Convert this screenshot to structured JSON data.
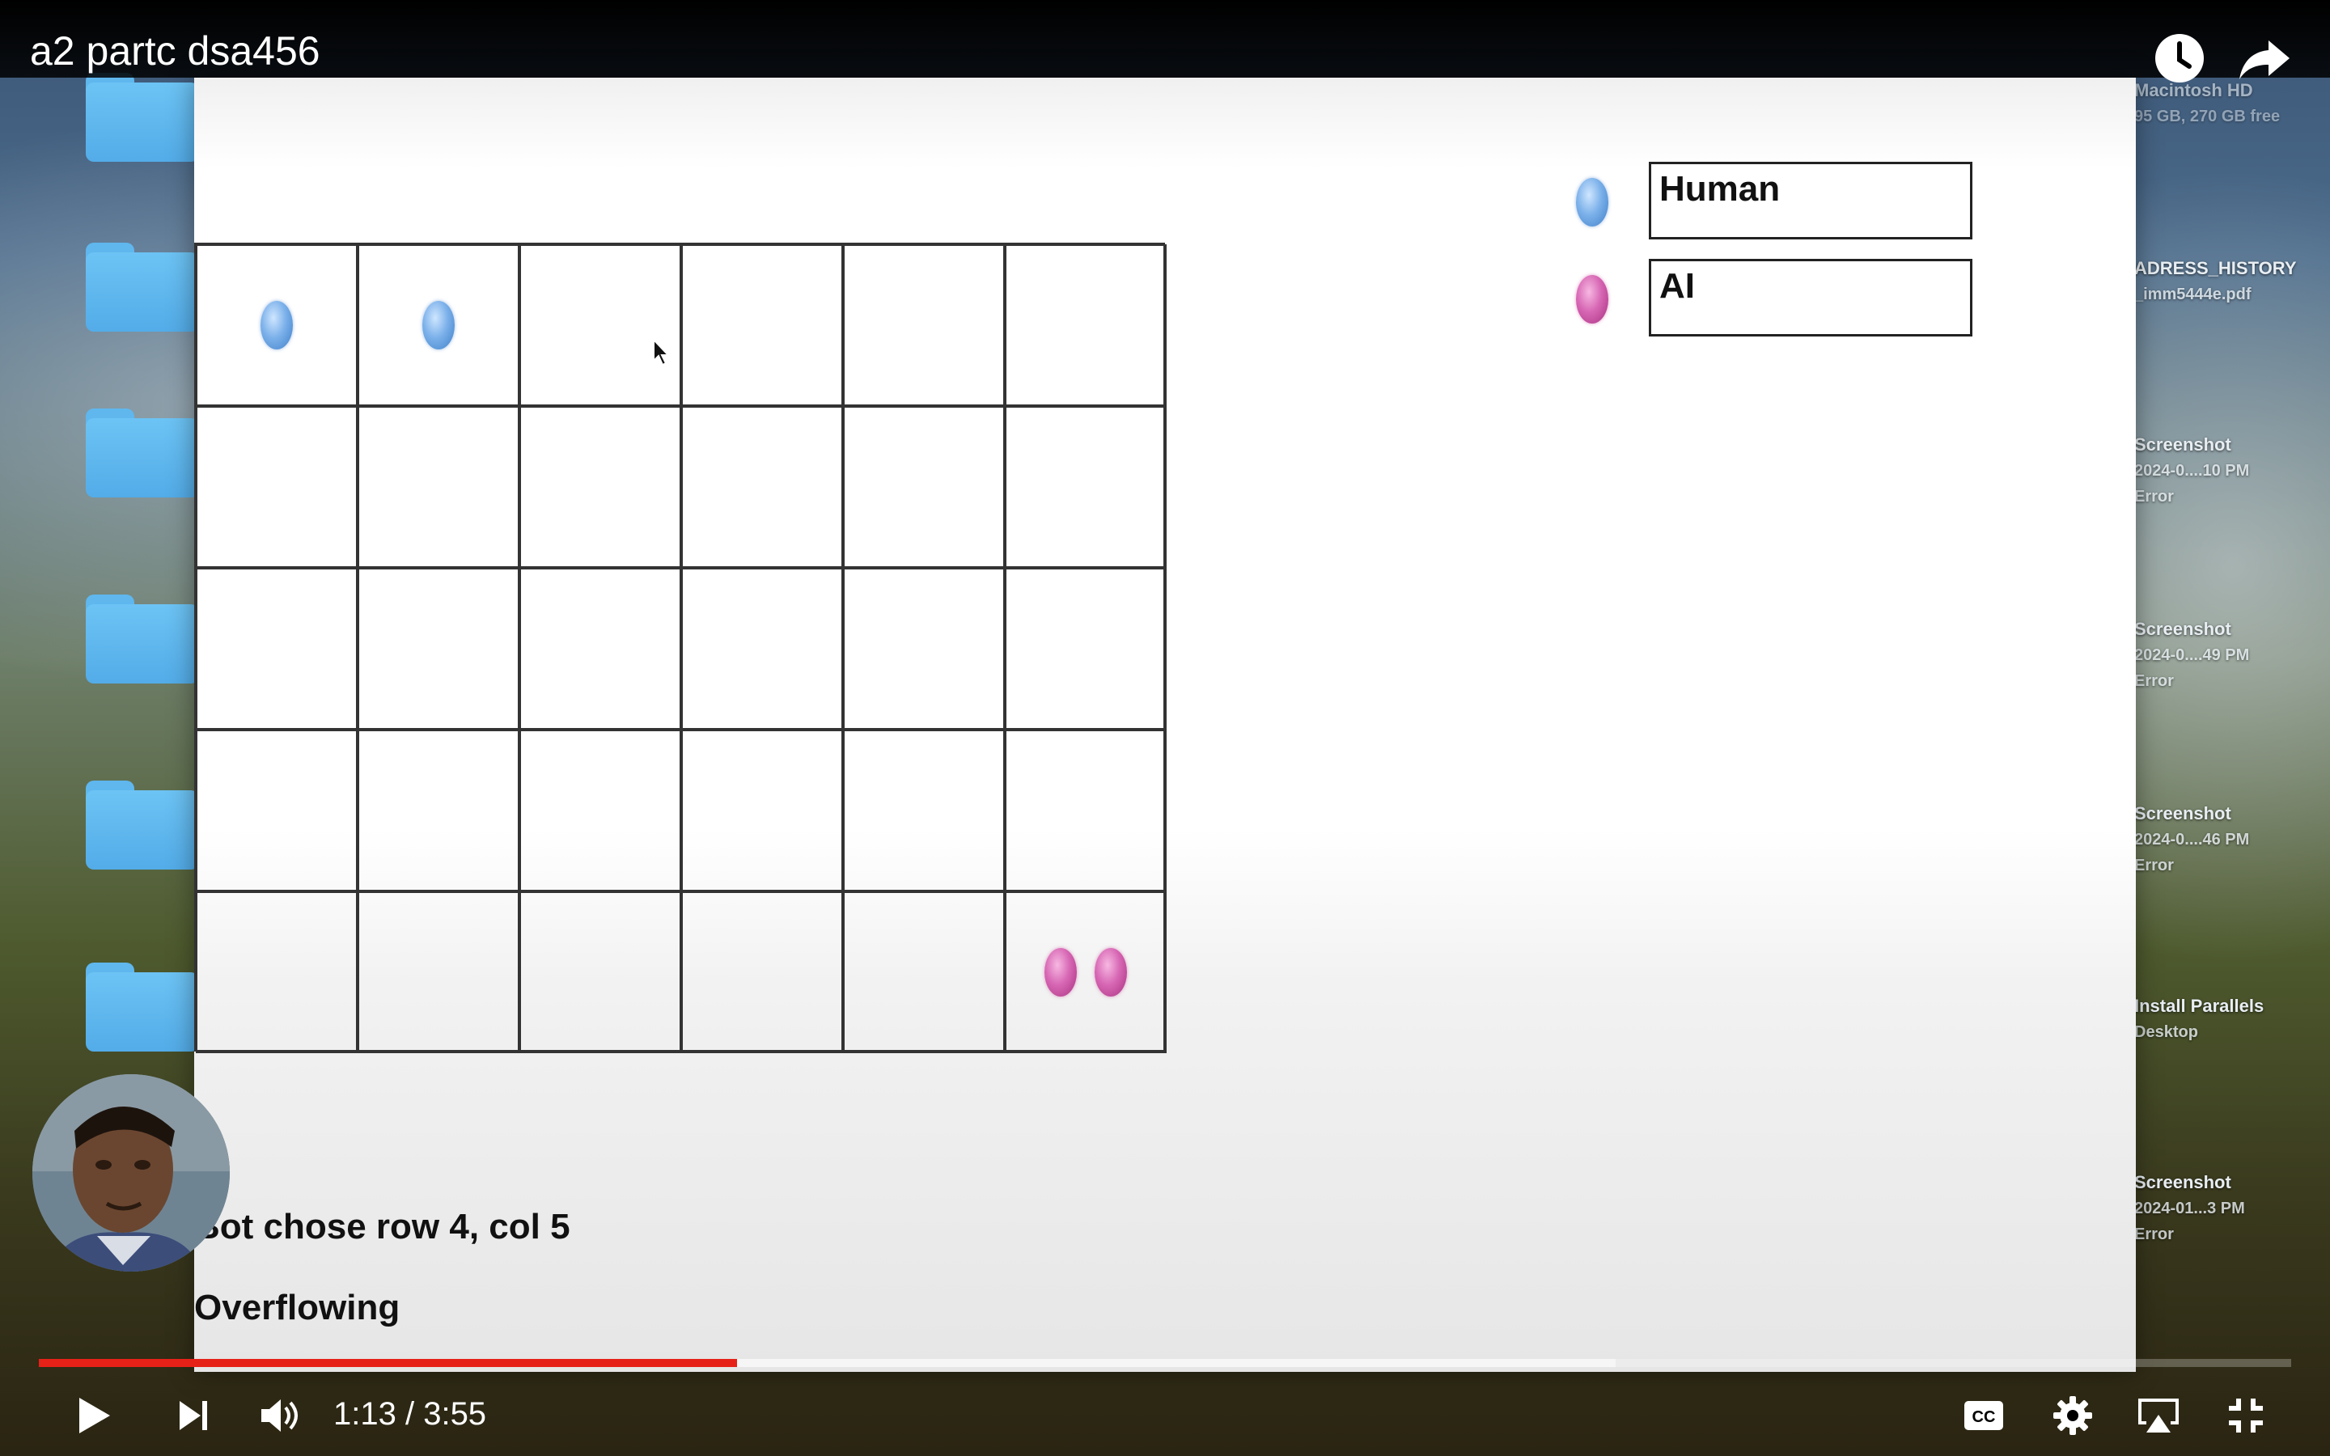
{
  "player": {
    "title": "a2 partc dsa456",
    "time_current": "1:13",
    "time_separator": " / ",
    "time_total": "3:55",
    "progress_fraction": 0.31,
    "buffered_fraction": 0.7,
    "played_color": "#e62117",
    "icons": {
      "watch_later": "clock-icon",
      "share": "share-arrow-icon",
      "play": "play-icon",
      "next": "skip-next-icon",
      "volume": "volume-icon",
      "captions": "cc-icon",
      "settings": "gear-icon",
      "airplay": "airplay-icon",
      "fullscreen": "exit-fullscreen-icon"
    }
  },
  "desktop": {
    "drive": {
      "name": "Macintosh HD",
      "info": "95 GB, 270 GB free"
    },
    "files": [
      {
        "name": "ADRESS_HISTORY",
        "sub": "_imm5444e.pdf"
      },
      {
        "name": "Screenshot",
        "sub": "2024-0....10 PM",
        "status": "Error"
      },
      {
        "name": "Screenshot",
        "sub": "2024-0....49 PM",
        "status": "Error"
      },
      {
        "name": "Screenshot",
        "sub": "2024-0....46 PM",
        "status": "Error"
      },
      {
        "name": "Install Parallels",
        "sub": "Desktop"
      },
      {
        "name": "Screenshot",
        "sub": "2024-01...3 PM",
        "status": "Error"
      }
    ]
  },
  "game": {
    "rows": 5,
    "cols": 6,
    "pieces": [
      {
        "row": 0,
        "col": 0,
        "owner": "human",
        "count": 1
      },
      {
        "row": 0,
        "col": 1,
        "owner": "human",
        "count": 1
      },
      {
        "row": 4,
        "col": 5,
        "owner": "ai",
        "count": 2
      }
    ],
    "colors": {
      "human": "#5e9be0",
      "ai": "#d14ea6"
    },
    "legend": [
      {
        "owner": "human",
        "label": "Human"
      },
      {
        "owner": "ai",
        "label": "AI"
      }
    ],
    "messages": {
      "bot_move": "Bot chose row 4, col 5",
      "status": "Overflowing"
    }
  }
}
